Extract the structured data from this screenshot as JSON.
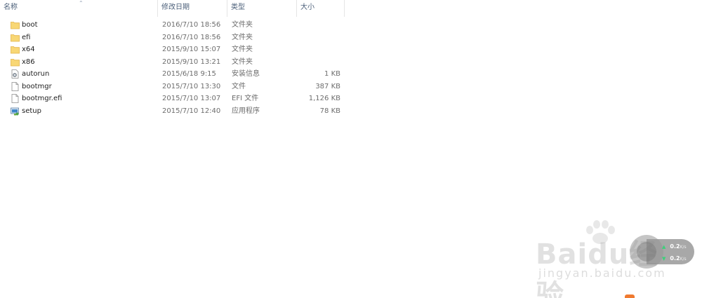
{
  "columns": {
    "name": "名称",
    "date": "修改日期",
    "type": "类型",
    "size": "大小"
  },
  "files": [
    {
      "name": "boot",
      "date": "2016/7/10 18:56",
      "type": "文件夹",
      "size": "",
      "icon": "folder-icon"
    },
    {
      "name": "efi",
      "date": "2016/7/10 18:56",
      "type": "文件夹",
      "size": "",
      "icon": "folder-icon"
    },
    {
      "name": "x64",
      "date": "2015/9/10 15:07",
      "type": "文件夹",
      "size": "",
      "icon": "folder-icon"
    },
    {
      "name": "x86",
      "date": "2015/9/10 13:21",
      "type": "文件夹",
      "size": "",
      "icon": "folder-icon"
    },
    {
      "name": "autorun",
      "date": "2015/6/18 9:15",
      "type": "安装信息",
      "size": "1 KB",
      "icon": "setup-info-file-icon"
    },
    {
      "name": "bootmgr",
      "date": "2015/7/10 13:30",
      "type": "文件",
      "size": "387 KB",
      "icon": "file-icon"
    },
    {
      "name": "bootmgr.efi",
      "date": "2015/7/10 13:07",
      "type": "EFI 文件",
      "size": "1,126 KB",
      "icon": "file-icon"
    },
    {
      "name": "setup",
      "date": "2015/7/10 12:40",
      "type": "应用程序",
      "size": "78 KB",
      "icon": "setup-app-icon"
    }
  ],
  "watermark": {
    "logo": "Baidu经验",
    "url": "jingyan.baidu.com"
  },
  "network": {
    "up": "0.2",
    "down": "0.2",
    "unit": "K/s"
  },
  "colors": {
    "folder": "#f8d775",
    "header_text": "#4c607a",
    "speed_arrow": "#3cd07a"
  }
}
